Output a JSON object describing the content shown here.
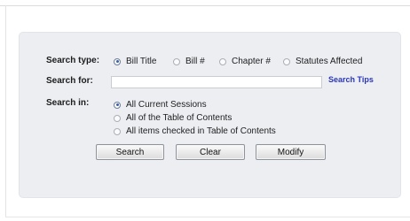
{
  "form": {
    "search_type": {
      "label": "Search type:",
      "options": [
        {
          "label": "Bill Title",
          "checked": true
        },
        {
          "label": "Bill #",
          "checked": false
        },
        {
          "label": "Chapter #",
          "checked": false
        },
        {
          "label": "Statutes Affected",
          "checked": false
        }
      ]
    },
    "search_for": {
      "label": "Search for:",
      "value": "",
      "placeholder": "",
      "tips_link": "Search Tips"
    },
    "search_in": {
      "label": "Search in:",
      "options": [
        {
          "label": "All Current Sessions",
          "checked": true
        },
        {
          "label": "All of the Table of Contents",
          "checked": false
        },
        {
          "label": "All items checked in Table of Contents",
          "checked": false
        }
      ]
    },
    "buttons": {
      "search": "Search",
      "clear": "Clear",
      "modify": "Modify"
    }
  },
  "colors": {
    "panel_background": "#eceef2",
    "link": "#2a36b8",
    "radio_selected": "#3a5fa8"
  }
}
